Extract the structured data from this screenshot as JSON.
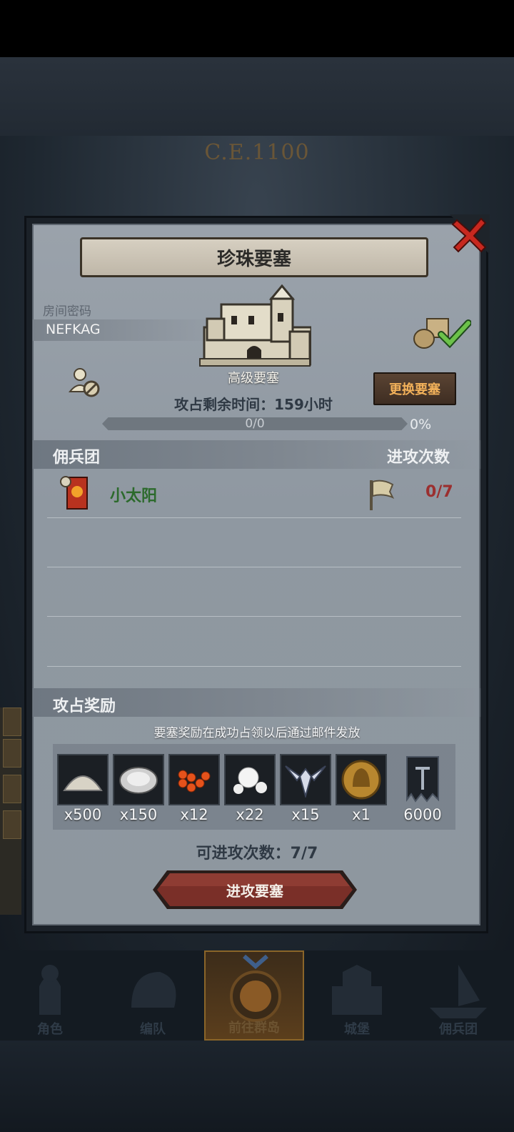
{
  "background": {
    "era_label": "C.E.1100"
  },
  "dialog": {
    "title": "珍珠要塞",
    "room_code_label": "房间密码",
    "room_code": "NEFKAG",
    "fortress_level": "高级要塞",
    "change_button": "更换要塞",
    "remaining_time": "攻占剩余时间：159小时",
    "progress_text": "0/0",
    "progress_percent": "0%",
    "progress_fraction": 0,
    "guild_section": {
      "title": "佣兵团",
      "attacks_header": "进攻次数"
    },
    "guilds": [
      {
        "name": "小太阳",
        "attacks": "0/7"
      }
    ],
    "rewards_section": {
      "title": "攻占奖励",
      "note": "要塞奖励在成功占领以后通过邮件发放",
      "items": [
        {
          "icon": "sand-pile-icon",
          "count": "x500"
        },
        {
          "icon": "oyster-icon",
          "count": "x150"
        },
        {
          "icon": "roe-icon",
          "count": "x12"
        },
        {
          "icon": "pearl-icon",
          "count": "x22"
        },
        {
          "icon": "winged-emblem-icon",
          "count": "x15"
        },
        {
          "icon": "helmet-coin-icon",
          "count": "x1"
        },
        {
          "icon": "guild-banner-icon",
          "count": "6000"
        }
      ]
    },
    "available_attacks": "可进攻次数：7/7",
    "attack_button": "进攻要塞"
  },
  "bottom_nav": [
    {
      "label": "角色",
      "icon": "knight-icon",
      "active": false
    },
    {
      "label": "编队",
      "icon": "helmet-icon",
      "active": false
    },
    {
      "label": "前往群岛",
      "icon": "compass-icon",
      "active": true
    },
    {
      "label": "城堡",
      "icon": "castle-icon",
      "active": false
    },
    {
      "label": "佣兵团",
      "icon": "ship-icon",
      "active": false
    }
  ],
  "colors": {
    "guild_name": "#2c6a2c",
    "attacks_count": "#9b2f2f",
    "change_button_text": "#f2b15a"
  }
}
